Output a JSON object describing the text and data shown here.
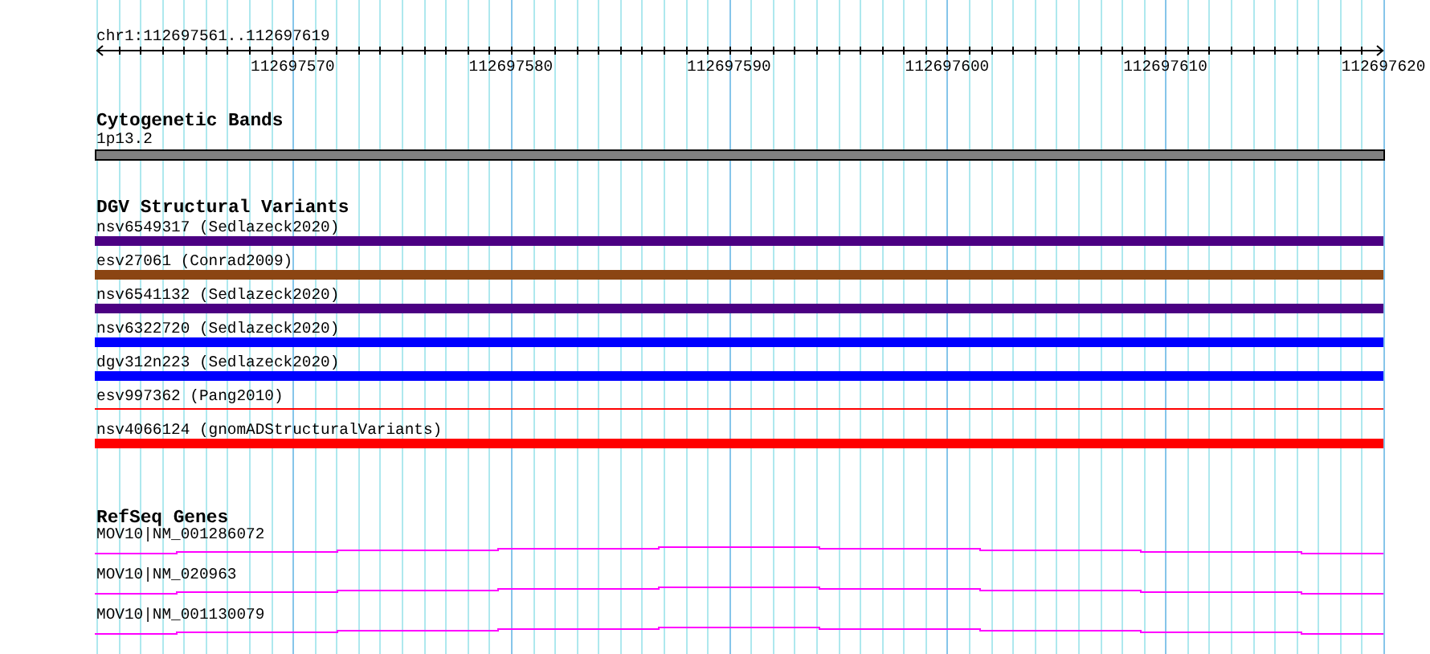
{
  "ruler": {
    "location": "chr1:112697561..112697619",
    "tick_labels": [
      "112697570",
      "112697580",
      "112697590",
      "112697600",
      "112697610",
      "112697620"
    ]
  },
  "cytogenetic_bands": {
    "title": "Cytogenetic Bands",
    "bands": [
      {
        "label": "1p13.2"
      }
    ]
  },
  "dgv_structural_variants": {
    "title": "DGV Structural Variants",
    "features": [
      {
        "label": "nsv6549317 (Sedlazeck2020)",
        "color": "#4b0082",
        "kind": "bar"
      },
      {
        "label": "esv27061 (Conrad2009)",
        "color": "#8b4513",
        "kind": "bar"
      },
      {
        "label": "nsv6541132 (Sedlazeck2020)",
        "color": "#4b0082",
        "kind": "bar"
      },
      {
        "label": "nsv6322720 (Sedlazeck2020)",
        "color": "#0000ff",
        "kind": "bar"
      },
      {
        "label": "dgv312n223 (Sedlazeck2020)",
        "color": "#0000ff",
        "kind": "bar"
      },
      {
        "label": "esv997362 (Pang2010)",
        "color": "#ff0000",
        "kind": "line"
      },
      {
        "label": "nsv4066124 (gnomADStructuralVariants)",
        "color": "#ff0000",
        "kind": "bar"
      }
    ]
  },
  "refseq_genes": {
    "title": "RefSeq Genes",
    "transcripts": [
      {
        "label": "MOV10|NM_001286072"
      },
      {
        "label": "MOV10|NM_020963"
      },
      {
        "label": "MOV10|NM_001130079"
      }
    ]
  }
}
